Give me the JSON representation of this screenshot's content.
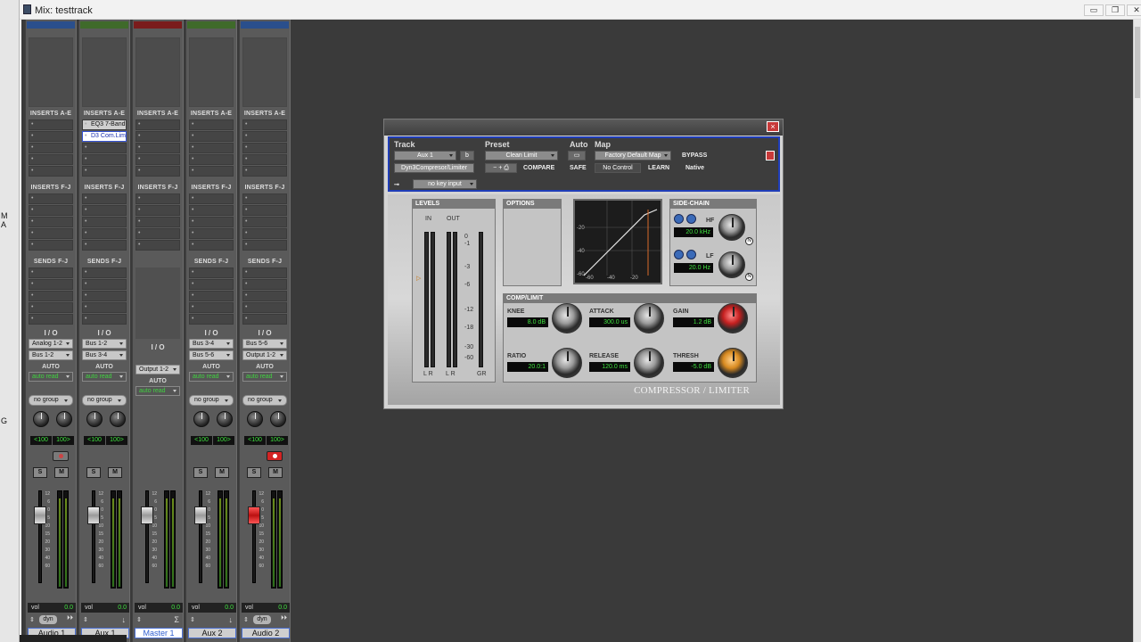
{
  "window": {
    "title": "Mix: testtrack",
    "minimize_label": "▭",
    "maximize_label": "❐",
    "close_label": "✕"
  },
  "left_strip": {
    "label_a": "M",
    "label_b": "A",
    "label_c": "G"
  },
  "strips": [
    {
      "name": "Audio 1",
      "color": "#2a4f8c",
      "inserts": [],
      "sends": true,
      "io_in": "Analog 1-2",
      "io_out": "Bus 1-2",
      "auto": "auto read",
      "group": "no group",
      "pan_l": "<100",
      "pan_r": "100>",
      "rec": true,
      "rec_on": false,
      "vol": "0.0",
      "bottom": "dyn",
      "fader_red": false
    },
    {
      "name": "Aux 1",
      "color": "#3f6a2a",
      "inserts": [
        "EQ3 7-Band",
        "D3 Com.Lim"
      ],
      "sends": true,
      "io_in": "Bus 1-2",
      "io_out": "Bus 3-4",
      "auto": "auto read",
      "group": "no group",
      "pan_l": "<100",
      "pan_r": "100>",
      "rec": false,
      "rec_on": false,
      "vol": "0.0",
      "bottom": "",
      "fader_red": false
    },
    {
      "name": "Master 1",
      "color": "#7a1c1c",
      "inserts": [],
      "sends": false,
      "io_in": "",
      "io_out": "Output 1-2",
      "auto": "auto read",
      "group": "",
      "pan_l": "",
      "pan_r": "",
      "rec": false,
      "rec_on": false,
      "vol": "0.0",
      "bottom": "",
      "fader_red": false
    },
    {
      "name": "Aux 2",
      "color": "#3f6a2a",
      "inserts": [],
      "sends": true,
      "io_in": "Bus 3-4",
      "io_out": "Bus 5-6",
      "auto": "auto read",
      "group": "no group",
      "pan_l": "<100",
      "pan_r": "100>",
      "rec": false,
      "rec_on": false,
      "vol": "0.0",
      "bottom": "",
      "fader_red": false
    },
    {
      "name": "Audio 2",
      "color": "#2a4f8c",
      "inserts": [],
      "sends": true,
      "io_in": "Bus 5-6",
      "io_out": "Output 1-2",
      "auto": "auto read",
      "group": "no group",
      "pan_l": "<100",
      "pan_r": "100>",
      "rec": true,
      "rec_on": true,
      "vol": "0.0",
      "bottom": "dyn",
      "fader_red": true
    }
  ],
  "labels": {
    "inserts_ae": "INSERTS A-E",
    "inserts_fj": "INSERTS F-J",
    "sends_fj": "SENDS F-J",
    "io": "I / O",
    "auto": "AUTO",
    "solo": "S",
    "mute": "M",
    "vol": "vol"
  },
  "fader_scale": [
    "12",
    "6",
    "0",
    "5",
    "10",
    "15",
    "20",
    "30",
    "40",
    "60"
  ],
  "plugin": {
    "hdr_track": "Track",
    "hdr_preset": "Preset",
    "hdr_auto": "Auto",
    "hdr_map": "Map",
    "track_name": "Aux 1",
    "track_slot": "b",
    "plugin_name": "Dyn3Compresor/Limiter",
    "preset_name": "Clean Limit",
    "preset_ctrl": "−  +  ⎙",
    "compare": "COMPARE",
    "safe": "SAFE",
    "map_name": "Factory Default Map",
    "no_control": "No Control",
    "learn": "LEARN",
    "bypass": "BYPASS",
    "native": "Native",
    "key_input": "no key input",
    "levels": "LEVELS",
    "in": "IN",
    "out": "OUT",
    "lr_in": "L  R",
    "lr_out": "L  R",
    "gr": "GR",
    "options": "OPTIONS",
    "sidechain": "SIDE-CHAIN",
    "hf": "HF",
    "hf_val": "20.0 kHz",
    "lf": "LF",
    "lf_val": "20.0 Hz",
    "complimit": "COMP/LIMIT",
    "knee": "KNEE",
    "knee_val": "8.0 dB",
    "attack": "ATTACK",
    "attack_val": "300.0 us",
    "gain": "GAIN",
    "gain_val": "1.2 dB",
    "ratio": "RATIO",
    "ratio_val": "20.0:1",
    "release": "RELEASE",
    "release_val": "120.0 ms",
    "thresh": "THRESH",
    "thresh_val": "-5.0 dB",
    "brand": "COMPRESSOR / LIMITER",
    "graph_y": [
      "-20",
      "-40",
      "-60"
    ],
    "graph_x": [
      "-60",
      "-40",
      "-20"
    ],
    "meter_scale": [
      "0",
      "-1",
      "-3",
      "-6",
      "-12",
      "-18",
      "-30",
      "-60"
    ],
    "in_marker": "▷",
    "ind_label": "N"
  }
}
